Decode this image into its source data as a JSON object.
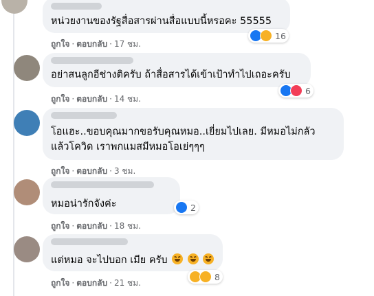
{
  "comments": [
    {
      "text_lines": [
        "หน่วยงานของรัฐสื่อสารผ่านสื่อแบบนี้หรอคะ 55555"
      ],
      "reactions": [
        "like",
        "haha"
      ],
      "reaction_count": "16",
      "actions": {
        "like": "ถูกใจ",
        "reply": "ตอบกลับ",
        "time": "17 ชม."
      }
    },
    {
      "text_lines": [
        "อย่าสนลูกอีช่างติครับ ถ้าสื่อสารได้เข้าเป้าทำไปเถอะครับ"
      ],
      "reactions": [
        "like",
        "love"
      ],
      "reaction_count": "6",
      "actions": {
        "like": "ถูกใจ",
        "reply": "ตอบกลับ",
        "time": "14 ชม."
      }
    },
    {
      "text_lines": [
        "โอแฮะ..ขอบคุณมากขอรับคุณหมอ..เยี่ยมไปเลย. มีหมอไม่กลัว",
        "แล้วโควิด เราพกแมสมีหมอโอเย่ๆๆๆ"
      ],
      "reactions": [],
      "reaction_count": "",
      "actions": {
        "like": "ถูกใจ",
        "reply": "ตอบกลับ",
        "time": "3 ชม."
      }
    },
    {
      "text_lines": [
        "หมอน่ารักจังค่ะ"
      ],
      "reactions": [
        "like"
      ],
      "reaction_count": "2",
      "actions": {
        "like": "ถูกใจ",
        "reply": "ตอบกลับ",
        "time": "18 ชม."
      }
    },
    {
      "text_lines": [
        "แต่หมอ จะไปบอก เมีย ครับ"
      ],
      "reactions": [
        "haha",
        "wow"
      ],
      "reaction_count": "8",
      "actions": {
        "like": "ถูกใจ",
        "reply": "ตอบกลับ",
        "time": "21 ชม."
      }
    }
  ],
  "colors": {
    "bubble": "#f0f2f5",
    "meta_text": "#65676b",
    "like_blue": "#1877f2",
    "haha_yellow": "#f7b125",
    "love_red": "#f33e58"
  }
}
